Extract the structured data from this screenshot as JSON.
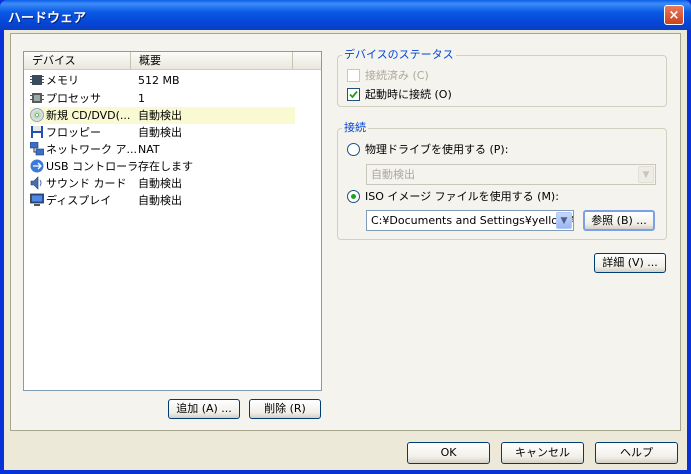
{
  "window": {
    "title": "ハードウェア",
    "close_glyph": "×"
  },
  "device_list": {
    "columns": [
      "デバイス",
      "概要"
    ],
    "rows": [
      {
        "name": "メモリ",
        "summary": "512 MB",
        "icon": "memory-icon",
        "selected": false
      },
      {
        "name": "プロセッサ",
        "summary": "1",
        "icon": "processor-icon",
        "selected": false
      },
      {
        "name": "新規 CD/DVD(...",
        "summary": "自動検出",
        "icon": "cd-dvd-icon",
        "selected": true
      },
      {
        "name": "フロッピー",
        "summary": "自動検出",
        "icon": "floppy-icon",
        "selected": false
      },
      {
        "name": "ネットワーク ア...",
        "summary": "NAT",
        "icon": "network-adapter-icon",
        "selected": false
      },
      {
        "name": "USB コントローラ",
        "summary": "存在します",
        "icon": "usb-icon",
        "selected": false
      },
      {
        "name": "サウンド カード",
        "summary": "自動検出",
        "icon": "sound-card-icon",
        "selected": false
      },
      {
        "name": "ディスプレイ",
        "summary": "自動検出",
        "icon": "display-icon",
        "selected": false
      }
    ],
    "add_label": "追加 (A) ...",
    "remove_label": "削除 (R)"
  },
  "device_status": {
    "legend": "デバイスのステータス",
    "connected_label": "接続済み (C)",
    "connected": false,
    "connected_enabled": false,
    "connect_at_power_on_label": "起動時に接続 (O)",
    "connect_at_power_on": true
  },
  "connection": {
    "legend": "接続",
    "physical_label": "物理ドライブを使用する (P):",
    "physical_selected": false,
    "physical_value": "自動検出",
    "iso_label": "ISO イメージ ファイルを使用する (M):",
    "iso_selected": true,
    "iso_path": "C:¥Documents and Settings¥yellow¥デ",
    "browse_label": "参照 (B) ..."
  },
  "advanced_label": "詳細 (V) ...",
  "footer": {
    "ok_label": "OK",
    "cancel_label": "キャンセル",
    "help_label": "ヘルプ"
  },
  "colors": {
    "title_bar": "#0a5ae6",
    "legend_text": "#0046d5",
    "selected_row": "#fafad2",
    "dialog_bg": "#ece9d8"
  }
}
